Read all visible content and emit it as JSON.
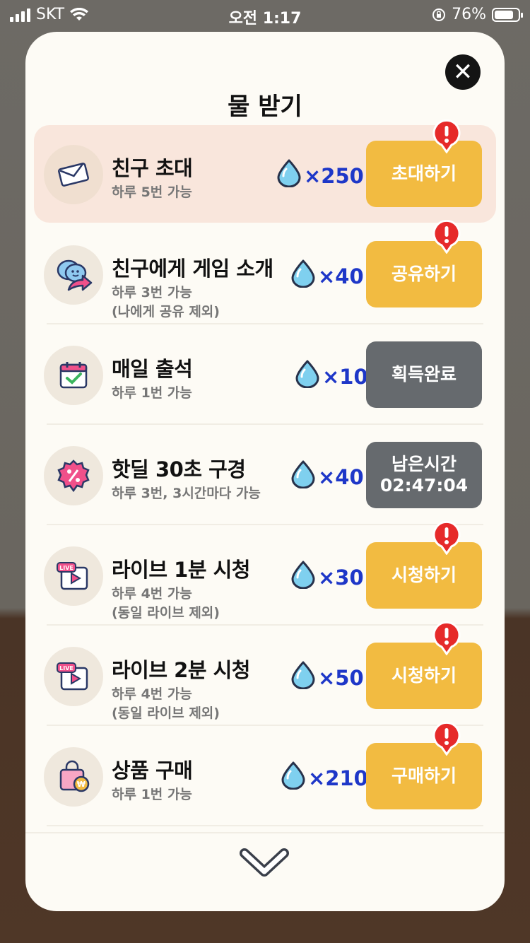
{
  "status_bar": {
    "carrier": "SKT",
    "time": "오전 1:17",
    "battery": "76%"
  },
  "modal": {
    "title": "물 받기"
  },
  "rows": [
    {
      "title": "친구 초대",
      "sub1": "하루 5번 가능",
      "sub2": "",
      "reward": "×250",
      "action": "초대하기",
      "action_line2": "",
      "state": "available",
      "alert": true,
      "highlight": true,
      "icon": "envelope-icon"
    },
    {
      "title": "친구에게 게임 소개",
      "sub1": "하루 3번 가능",
      "sub2": "(나에게 공유 제외)",
      "reward": "×40",
      "action": "공유하기",
      "action_line2": "",
      "state": "available",
      "alert": true,
      "highlight": false,
      "icon": "share-chat-icon"
    },
    {
      "title": "매일 출석",
      "sub1": "하루 1번 가능",
      "sub2": "",
      "reward": "×10",
      "action": "획득완료",
      "action_line2": "",
      "state": "done",
      "alert": false,
      "highlight": false,
      "icon": "calendar-check-icon"
    },
    {
      "title": "핫딜 30초 구경",
      "sub1": "하루 3번, 3시간마다 가능",
      "sub2": "",
      "reward": "×40",
      "action": "남은시간",
      "action_line2": "02:47:04",
      "state": "done",
      "alert": false,
      "highlight": false,
      "icon": "discount-badge-icon"
    },
    {
      "title": "라이브 1분 시청",
      "sub1": "하루 4번 가능",
      "sub2": "(동일 라이브 제외)",
      "reward": "×30",
      "action": "시청하기",
      "action_line2": "",
      "state": "available",
      "alert": true,
      "highlight": false,
      "icon": "live-video-icon"
    },
    {
      "title": "라이브 2분 시청",
      "sub1": "하루 4번 가능",
      "sub2": "(동일 라이브 제외)",
      "reward": "×50",
      "action": "시청하기",
      "action_line2": "",
      "state": "available",
      "alert": true,
      "highlight": false,
      "icon": "live-video-icon"
    },
    {
      "title": "상품 구매",
      "sub1": "하루 1번 가능",
      "sub2": "",
      "reward": "×210",
      "action": "구매하기",
      "action_line2": "",
      "state": "available",
      "alert": true,
      "highlight": false,
      "icon": "shopping-bag-icon"
    }
  ],
  "live_badge": "LIVE",
  "colors": {
    "accent_button": "#f2bb41",
    "done_button": "#666a6e",
    "reward_text": "#1e37c8",
    "alert_red": "#e62a2a"
  }
}
